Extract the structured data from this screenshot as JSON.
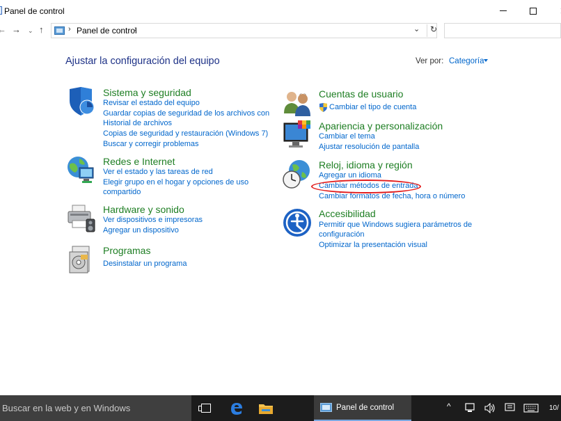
{
  "window": {
    "title": "Panel de control"
  },
  "address_bar": {
    "path": "Panel de control",
    "separator": "›",
    "dropdown": "⌄",
    "refresh": "↻"
  },
  "main": {
    "heading": "Ajustar la configuración del equipo",
    "view_by_label": "Ver por:",
    "view_by_value": "Categoría"
  },
  "categories": {
    "sistema": {
      "title": "Sistema y seguridad",
      "links": [
        "Revisar el estado del equipo",
        "Guardar copias de seguridad de los archivos con",
        "Historial de archivos",
        "Copias de seguridad y restauración (Windows 7)",
        "Buscar y corregir problemas"
      ]
    },
    "redes": {
      "title": "Redes e Internet",
      "links": [
        "Ver el estado y las tareas de red",
        "Elegir grupo en el hogar y opciones de uso",
        "compartido"
      ]
    },
    "hardware": {
      "title": "Hardware y sonido",
      "links": [
        "Ver dispositivos e impresoras",
        "Agregar un dispositivo"
      ]
    },
    "programas": {
      "title": "Programas",
      "links": [
        "Desinstalar un programa"
      ]
    },
    "cuentas": {
      "title": "Cuentas de usuario",
      "links": [
        "Cambiar el tipo de cuenta"
      ]
    },
    "apariencia": {
      "title": "Apariencia y personalización",
      "links": [
        "Cambiar el tema",
        "Ajustar resolución de pantalla"
      ]
    },
    "reloj": {
      "title": "Reloj, idioma y región",
      "links": [
        "Agregar un idioma",
        "Cambiar métodos de entrada",
        "Cambiar formatos de fecha, hora o número"
      ]
    },
    "accesibilidad": {
      "title": "Accesibilidad",
      "links": [
        "Permitir que Windows sugiera parámetros de",
        "configuración",
        "Optimizar la presentación visual"
      ]
    }
  },
  "taskbar": {
    "search_placeholder": "Buscar en la web y en Windows",
    "active_app": "Panel de control",
    "clock_fragment": "10/"
  },
  "colors": {
    "link": "#0066cc",
    "category_title": "#1e7e23",
    "heading": "#1e3287",
    "highlight_circle": "#e21b1b",
    "taskbar": "#1c1c1c"
  }
}
